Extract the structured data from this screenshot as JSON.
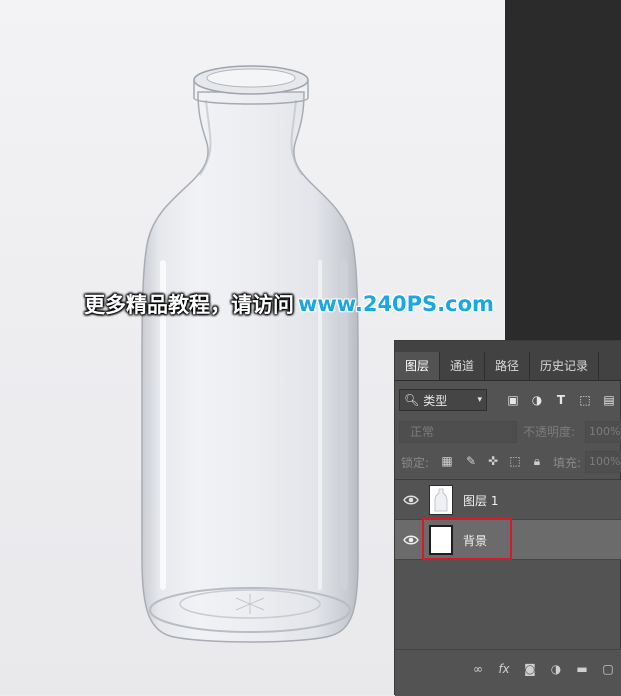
{
  "watermark": {
    "text_cn": "更多精品教程，请访问",
    "url": "www.240PS.com"
  },
  "layers_panel": {
    "tabs": [
      {
        "label": "图层",
        "active": true
      },
      {
        "label": "通道",
        "active": false
      },
      {
        "label": "路径",
        "active": false
      },
      {
        "label": "历史记录",
        "active": false
      }
    ],
    "filter": {
      "kind_label": "类型",
      "icons": [
        "image-filter-icon",
        "adjustment-filter-icon",
        "type-filter-icon",
        "shape-filter-icon",
        "smart-object-filter-icon"
      ]
    },
    "blend_mode": "正常",
    "opacity_label": "不透明度:",
    "opacity_value": "100%",
    "lock_label": "锁定:",
    "fill_label": "填充:",
    "fill_value": "100%",
    "layers": [
      {
        "name": "图层 1",
        "visible": true,
        "selected": false
      },
      {
        "name": "背景",
        "visible": true,
        "selected": true
      }
    ],
    "highlight_color": "#d9182d"
  },
  "colors": {
    "panel_bg": "#535353",
    "selected_layer_bg": "#6b6b6b",
    "watermark_url": "#1aa7e3"
  }
}
